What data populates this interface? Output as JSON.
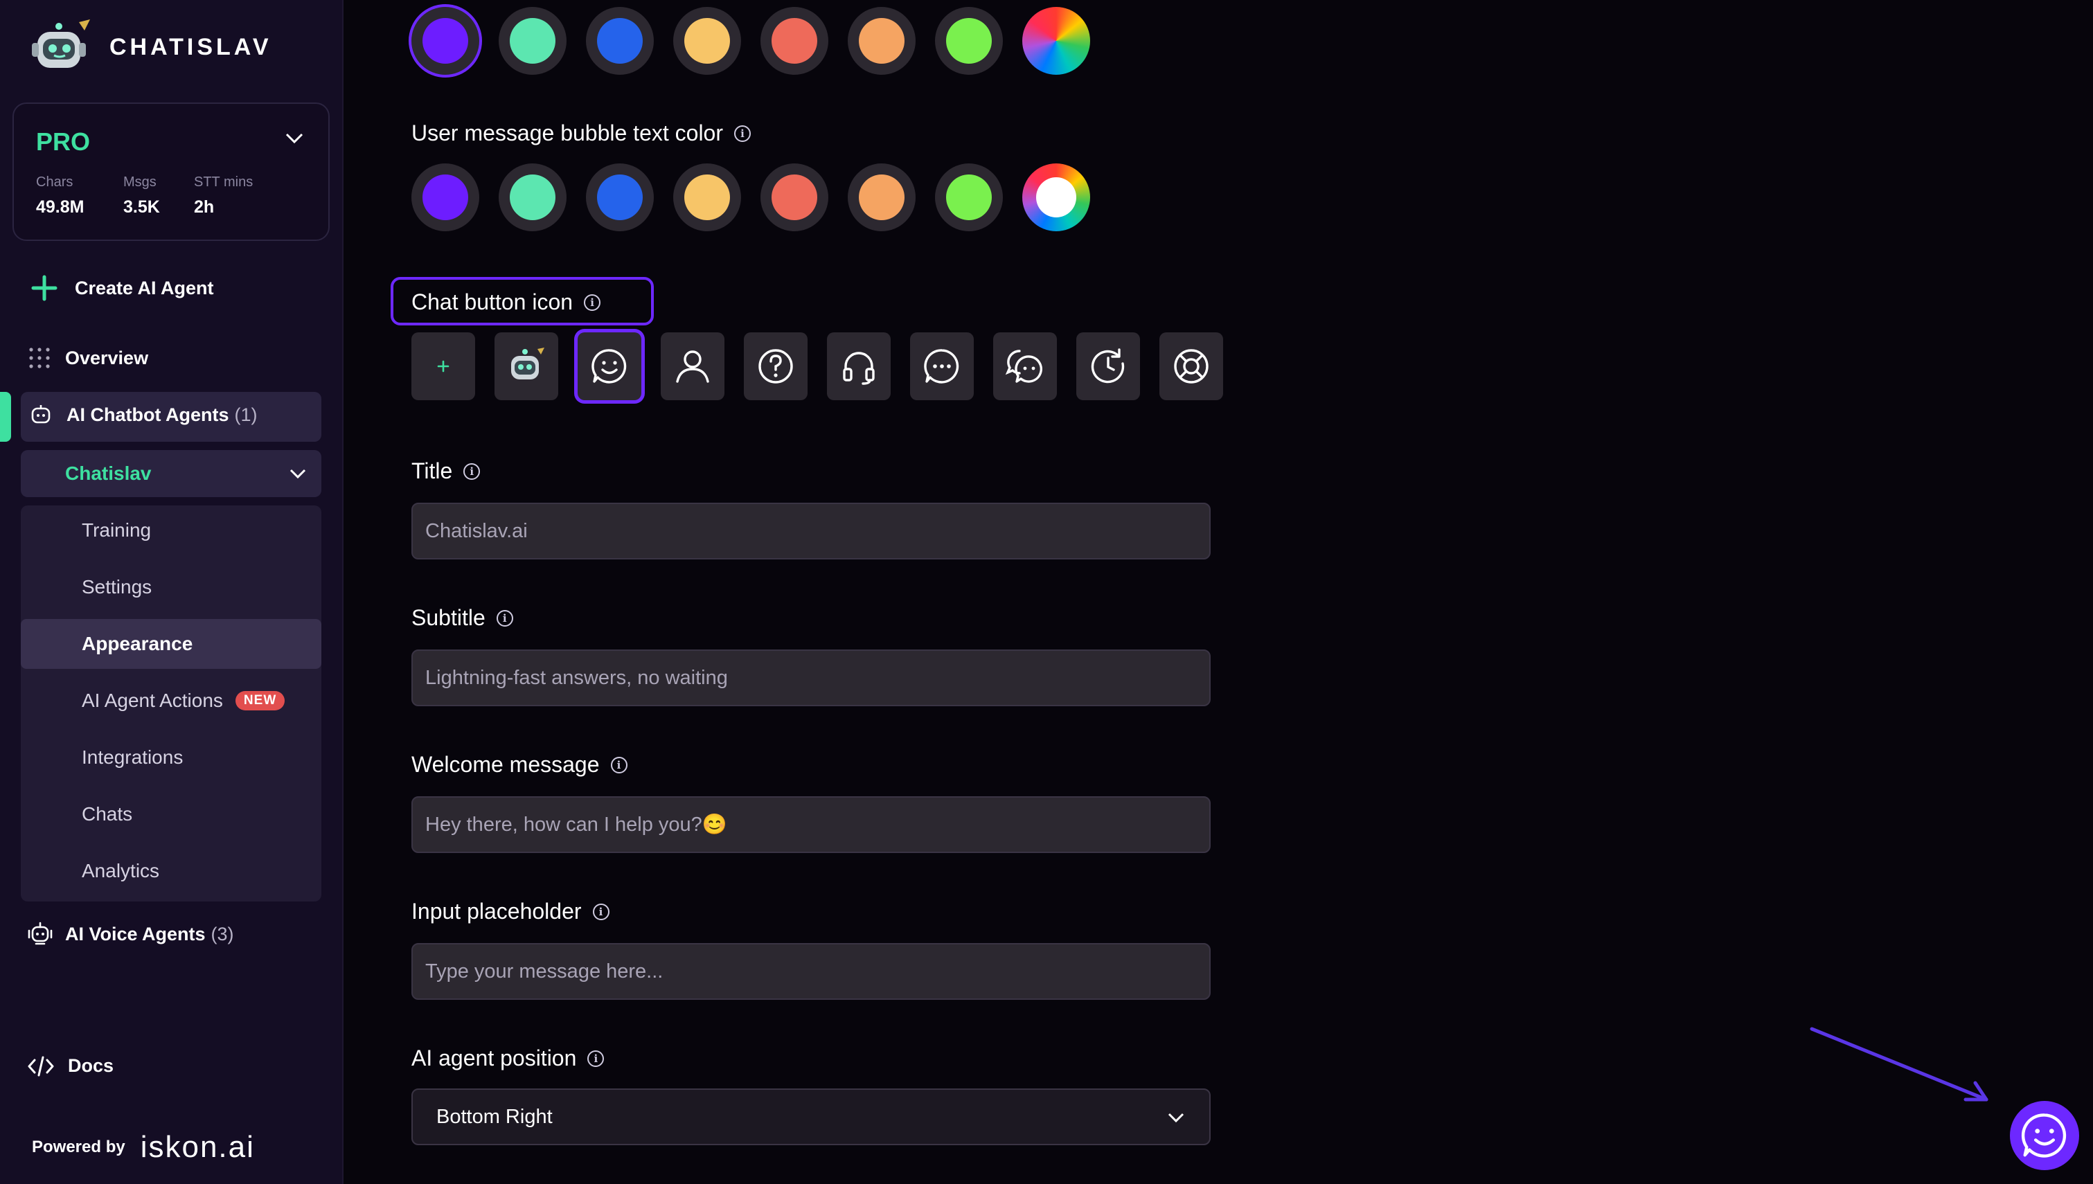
{
  "app": {
    "name": "CHATISLAV"
  },
  "plan": {
    "name": "PRO",
    "stats": [
      {
        "label": "Chars",
        "value": "49.8M"
      },
      {
        "label": "Msgs",
        "value": "3.5K"
      },
      {
        "label": "STT mins",
        "value": "2h"
      }
    ]
  },
  "nav": {
    "create": "Create AI Agent",
    "overview": "Overview",
    "chatbot_agents": "AI Chatbot Agents",
    "chatbot_count": "(1)",
    "selected_agent": "Chatislav",
    "submenu": [
      "Training",
      "Settings",
      "Appearance",
      "AI Agent Actions",
      "Integrations",
      "Chats",
      "Analytics"
    ],
    "submenu_active": "Appearance",
    "new_badge": "NEW",
    "voice_agents": "AI Voice Agents",
    "voice_count": "(3)",
    "docs": "Docs"
  },
  "footer": {
    "powered_by": "Powered by",
    "brand": "iskon.ai"
  },
  "colors": {
    "accent": "#6d28ff",
    "brand_green": "#3ee0a0",
    "swatches": [
      "#6d1dff",
      "#5ce6b0",
      "#2563eb",
      "#f7c568",
      "#ee6a5a",
      "#f5a462",
      "#7af04e"
    ]
  },
  "appearance": {
    "bubble_text_color_label": "User message bubble text color",
    "chat_button_icon_label": "Chat button icon",
    "chat_button_icons": [
      "plus-icon",
      "robot-avatar-icon",
      "smiley-chat-icon",
      "user-icon",
      "question-icon",
      "headset-icon",
      "chat-dots-icon",
      "chat-bubbles-icon",
      "history-icon",
      "lifebuoy-icon"
    ],
    "selected_icon": "smiley-chat-icon",
    "title_label": "Title",
    "title_value": "Chatislav.ai",
    "subtitle_label": "Subtitle",
    "subtitle_value": "Lightning-fast answers, no waiting",
    "welcome_label": "Welcome message",
    "welcome_value": "Hey there, how can I help you?😊",
    "placeholder_label": "Input placeholder",
    "placeholder_value": "Type your message here...",
    "position_label": "AI agent position",
    "position_value": "Bottom Right"
  }
}
